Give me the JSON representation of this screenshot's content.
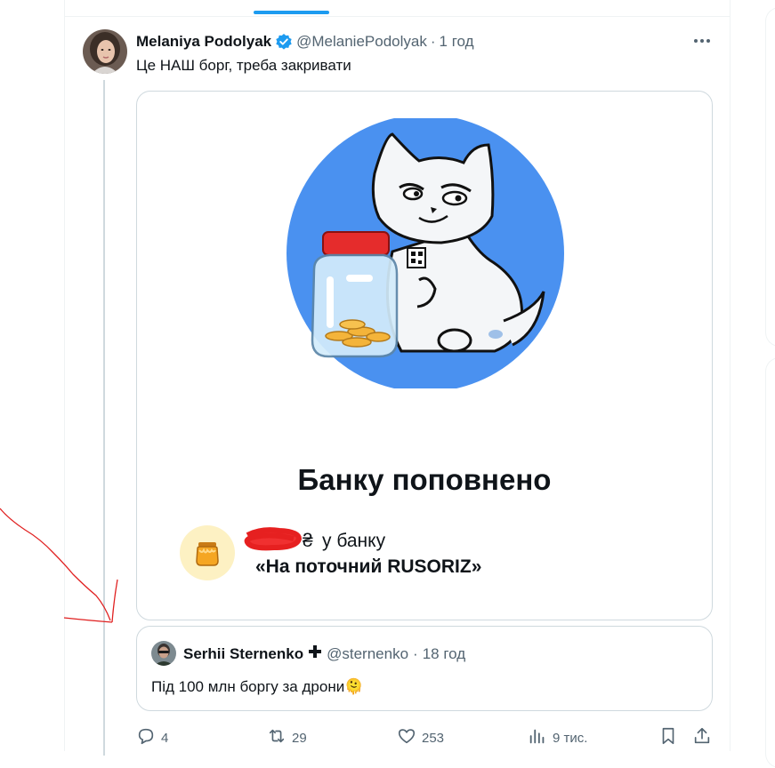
{
  "tweet": {
    "author_name": "Melaniya Podolyak",
    "author_handle": "@MelaniePodolyak",
    "separator": "·",
    "time": "1 год",
    "text": "Це НАШ борг, треба закривати"
  },
  "media": {
    "title": "Банку поповнено",
    "currency_symbol": "₴",
    "in_bank": "у банку",
    "jar_name": "«На поточний RUSORIZ»"
  },
  "quote": {
    "author_name": "Serhii Sternenko",
    "author_handle": "@sternenko",
    "separator": "·",
    "time": "18 год",
    "text": "Під 100 млн боргу за дрони🫠"
  },
  "actions": {
    "replies": "4",
    "reposts": "29",
    "likes": "253",
    "views": "9 тис."
  },
  "colors": {
    "accent": "#1d9bf0",
    "secondary_text": "#536471",
    "annotation": "#e02020"
  },
  "icons": [
    "verified-badge-icon",
    "more-icon",
    "reply-icon",
    "repost-icon",
    "like-icon",
    "views-icon",
    "bookmark-icon",
    "share-icon"
  ]
}
